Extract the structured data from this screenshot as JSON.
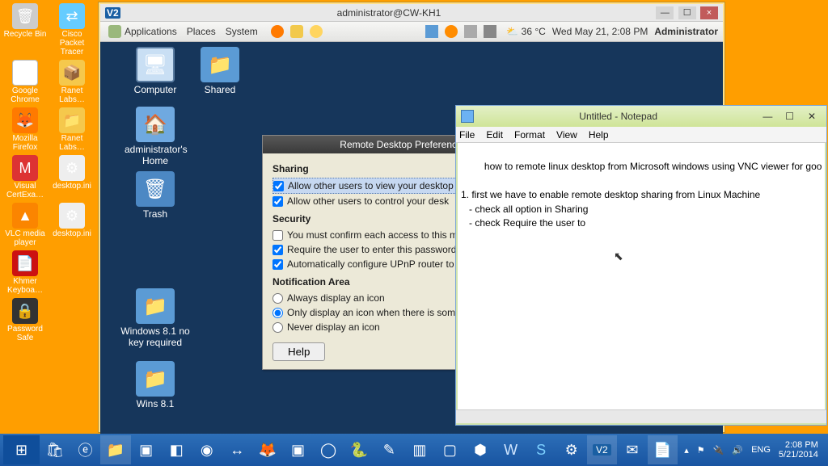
{
  "desktop_icons": {
    "recycle": "Recycle Bin",
    "packet": "Cisco Packet Tracer",
    "chrome": "Google Chrome",
    "ranet1": "Ranet Labs…",
    "firefox": "Mozilla Firefox",
    "ranet2": "Ranet Labs…",
    "visual": "Visual CertExa…",
    "ini1": "desktop.ini",
    "vlc": "VLC media player",
    "ini2": "desktop.ini",
    "khmer": "Khmer Keyboa…",
    "psafe": "Password Safe"
  },
  "vnc": {
    "logo": "V2",
    "title": "administrator@CW-KH1",
    "min": "—",
    "max": "☐",
    "close": "×",
    "menus": {
      "apps": "Applications",
      "places": "Places",
      "system": "System"
    },
    "weather": "36 °C",
    "clock": "Wed May 21,  2:08 PM",
    "user": "Administrator",
    "gicons": {
      "computer": "Computer",
      "shared": "Shared",
      "home": "administrator's Home",
      "trash": "Trash",
      "win81nk": "Windows 8.1 no key required",
      "wins81": "Wins 8.1"
    }
  },
  "prefs": {
    "title": "Remote Desktop Preferences",
    "sharing_hd": "Sharing",
    "opt_view": "Allow other users to view your desktop",
    "opt_ctrl": "Allow other users to control your desk",
    "security_hd": "Security",
    "opt_confirm": "You must confirm each access to this ma",
    "opt_pass": "Require the user to enter this password:",
    "opt_upnp": "Automatically configure UPnP router to o",
    "notif_hd": "Notification Area",
    "opt_always": "Always display an icon",
    "opt_some": "Only display an icon when there is some",
    "opt_never": "Never display an icon",
    "help": "Help"
  },
  "notepad": {
    "title": "Untitled - Notepad",
    "menu": {
      "file": "File",
      "edit": "Edit",
      "format": "Format",
      "view": "View",
      "help": "Help"
    },
    "content": "how to remote linux desktop from Microsoft windows using VNC viewer for goo\n\n1. first we have to enable remote desktop sharing from Linux Machine\n   - check all option in Sharing\n   - check Require the user to "
  },
  "taskbar": {
    "lang": "ENG",
    "time": "2:08 PM",
    "date": "5/21/2014"
  }
}
